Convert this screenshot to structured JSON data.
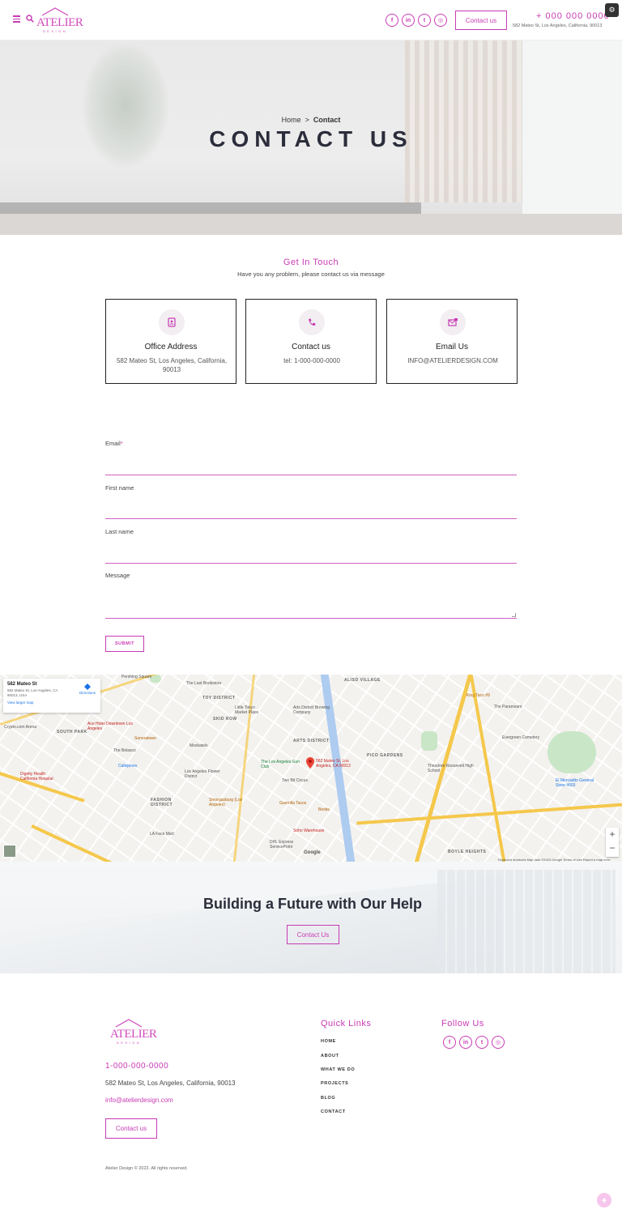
{
  "header": {
    "logo_text": "ATELIER",
    "logo_sub": "DESIGN",
    "social": [
      {
        "icon": "facebook-icon",
        "glyph": "f"
      },
      {
        "icon": "linkedin-icon",
        "glyph": "in"
      },
      {
        "icon": "twitter-icon",
        "glyph": "t"
      },
      {
        "icon": "instagram-icon",
        "glyph": "◎"
      }
    ],
    "contact_button": "Contact us",
    "phone": "+ 000 000 0000",
    "address": "582 Mateo St, Los Angeles, California, 90013"
  },
  "hero": {
    "breadcrumb_home": "Home",
    "breadcrumb_sep": ">",
    "breadcrumb_current": "Contact",
    "title": "CONTACT US"
  },
  "touch": {
    "title": "Get In Touch",
    "subtitle": "Have you any problem, please contact us via message",
    "cards": [
      {
        "icon": "address-book-icon",
        "title": "Office Address",
        "text": "582 Mateo St, Los Angeles, California, 90013"
      },
      {
        "icon": "phone-icon",
        "title": "Contact us",
        "text": "tel: 1-000-000-0000"
      },
      {
        "icon": "email-icon",
        "title": "Email Us",
        "text": "INFO@ATELIERDESIGN.COM"
      }
    ]
  },
  "form": {
    "email_label": "Email",
    "required_mark": "*",
    "first_name_label": "First name",
    "last_name_label": "Last name",
    "message_label": "Message",
    "submit_label": "SUBMIT"
  },
  "map": {
    "place_title": "582 Mateo St",
    "place_address": "582 Mateo St, Los Angeles, CA 90013, USA",
    "larger_map": "View larger map",
    "directions": "Directions",
    "pin_label": "582 Mateo St, Los Angeles, CA 90013",
    "google": "Google",
    "footer_text": "Keyboard shortcuts   Map data ©2023 Google   Terms of Use   Report a map error",
    "labels": {
      "aliso": "ALISO VILLAGE",
      "toy": "TOY DISTRICT",
      "skid": "SKID ROW",
      "arts": "ARTS DISTRICT",
      "pico": "PICO GARDENS",
      "south_park": "SOUTH PARK",
      "fashion": "FASHION DISTRICT",
      "boyle": "BOYLE HEIGHTS",
      "little_tokyo": "Little Tokyo Market Place",
      "arts_brew": "Arts District Brewing Company",
      "gun_club": "The Los Angeles Gun Club",
      "two_bit": "Two Bit Circus",
      "soho": "Soho Warehouse",
      "bestia": "Bestia",
      "guerrilla": "Guerrilla Tacos",
      "smorgas": "Smorgasburg (Los Angeles)",
      "flower": "Los Angeles Flower District",
      "moskatels": "Moskatels",
      "callejones": "Callejones",
      "belasco": "The Belasco",
      "sonora": "Sonoratown",
      "ace": "Ace Hotel Downtown Los Angeles",
      "crypto": "Crypto.com Arena",
      "pershing": "Pershing Square",
      "bookstore": "The Last Bookstore",
      "roosevelt": "Theodore Roosevelt High School",
      "evergreen": "Evergreen Cemetery",
      "paramount": "The Paramount",
      "king_taco": "King Taco #9",
      "dignity": "Dignity Health California Hospital",
      "la_face": "LA Face Mart",
      "dhl": "DHL Express ServicePoint",
      "mercadito": "El Mercadito General Store #003"
    }
  },
  "banner": {
    "title": "Building a Future with Our Help",
    "button": "Contact Us"
  },
  "footer": {
    "logo_text": "ATELIER",
    "logo_sub": "DESIGN",
    "phone": "1-000-000-0000",
    "address": "582 Mateo St, Los Angeles, California, 90013",
    "email": "info@atelierdesign.com",
    "contact_button": "Contact us",
    "quick_links_title": "Quick Links",
    "links": [
      "HOME",
      "ABOUT",
      "WHAT WE DO",
      "PROJECTS",
      "BLOG",
      "CONTACT"
    ],
    "follow_title": "Follow Us",
    "copyright": "Atelier Design © 2022. All rights reserved."
  },
  "colors": {
    "accent": "#c83bb4",
    "dark": "#2b2d3b"
  }
}
